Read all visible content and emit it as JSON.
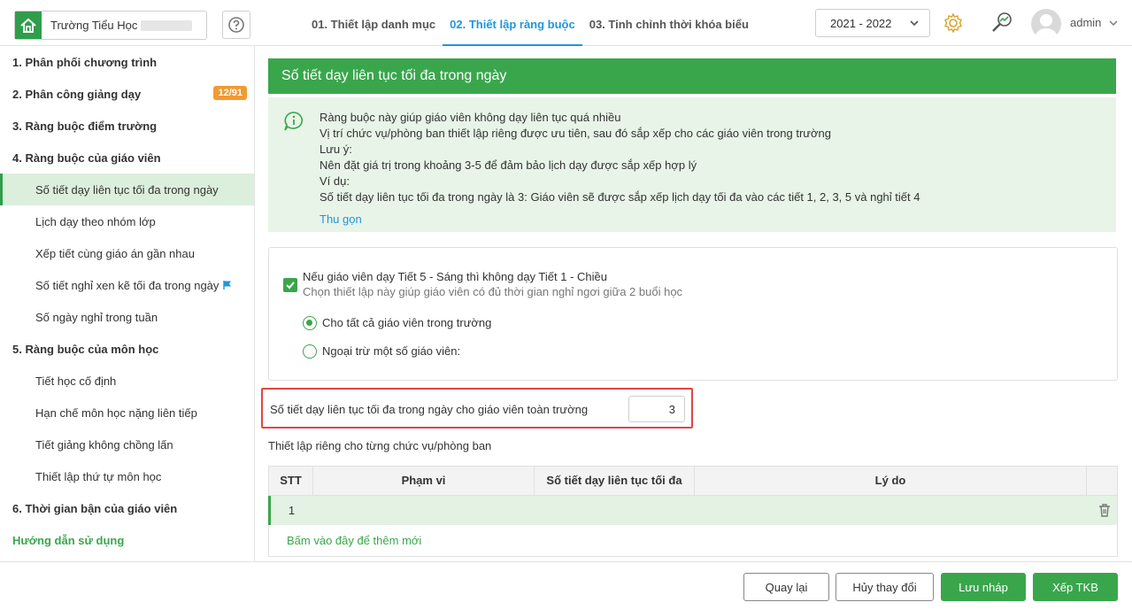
{
  "header": {
    "school_name": "Trường Tiểu Học",
    "tabs": [
      "01. Thiết lập danh mục",
      "02. Thiết lập ràng buộc",
      "03. Tinh chỉnh thời khóa biểu"
    ],
    "active_tab": 1,
    "year": "2021 - 2022",
    "user": "admin"
  },
  "sidebar": {
    "items": [
      {
        "label": "1. Phân phối chương trình",
        "type": "group"
      },
      {
        "label": "2. Phân công giảng dạy",
        "type": "group",
        "badge": "12/91"
      },
      {
        "label": "3. Ràng buộc điểm trường",
        "type": "group"
      },
      {
        "label": "4. Ràng buộc của giáo viên",
        "type": "group"
      },
      {
        "label": "Số tiết dạy liên tục tối đa trong ngày",
        "type": "sub",
        "active": true
      },
      {
        "label": "Lịch dạy theo nhóm lớp",
        "type": "sub"
      },
      {
        "label": "Xếp tiết cùng giáo án gần nhau",
        "type": "sub"
      },
      {
        "label": "Số tiết nghỉ xen kẽ tối đa trong ngày",
        "type": "sub",
        "flag": true
      },
      {
        "label": "Số ngày nghỉ trong tuần",
        "type": "sub"
      },
      {
        "label": "5. Ràng buộc của môn học",
        "type": "group"
      },
      {
        "label": "Tiết học cố định",
        "type": "sub"
      },
      {
        "label": "Hạn chế môn học nặng liên tiếp",
        "type": "sub"
      },
      {
        "label": "Tiết giảng không chồng lấn",
        "type": "sub"
      },
      {
        "label": "Thiết lập thứ tự môn học",
        "type": "sub"
      },
      {
        "label": "6. Thời gian bận của giáo viên",
        "type": "group"
      },
      {
        "label": "Hướng dẫn sử dụng",
        "type": "guide"
      }
    ]
  },
  "main": {
    "title": "Số tiết dạy liên tục tối đa trong ngày",
    "info_lines": [
      "Ràng buộc này giúp giáo viên không dạy liên tục quá nhiều",
      "Vị trí chức vụ/phòng ban thiết lập riêng được ưu tiên, sau đó sắp xếp cho các giáo viên trong trường",
      "Lưu ý:",
      "Nên đặt giá trị trong khoảng 3-5 để đảm bảo lịch dạy được sắp xếp hợp lý",
      "Ví dụ:",
      "Số tiết dạy liên tục tối đa trong ngày là 3: Giáo viên sẽ được sắp xếp lịch dạy tối đa vào các tiết 1, 2, 3, 5 và nghỉ tiết 4"
    ],
    "collapse": "Thu gọn",
    "checkbox_label": "Nếu giáo viên dạy Tiết 5 - Sáng thì không dạy Tiết 1 - Chiều",
    "checkbox_sub": "Chọn thiết lập này giúp giáo viên có đủ thời gian nghỉ ngơi giữa 2 buổi học",
    "radio_all": "Cho tất cả giáo viên trong trường",
    "radio_except": "Ngoại trừ một số giáo viên:",
    "max_label": "Số tiết dạy liên tục tối đa trong ngày cho giáo viên toàn trường",
    "max_value": "3",
    "section_title": "Thiết lập riêng cho từng chức vụ/phòng ban",
    "table": {
      "headers": [
        "STT",
        "Phạm vi",
        "Số tiết dạy liên tục tối đa",
        "Lý do"
      ],
      "rows": [
        {
          "stt": "1"
        }
      ],
      "add_new": "Bấm vào đây để thêm mới"
    }
  },
  "footer": {
    "back": "Quay lại",
    "cancel": "Hủy thay đổi",
    "save_draft": "Lưu nháp",
    "arrange": "Xếp TKB"
  },
  "colors": {
    "green": "#3aa64c",
    "blue": "#2196d8",
    "badge": "#f39a31",
    "highlight": "#e04646"
  }
}
